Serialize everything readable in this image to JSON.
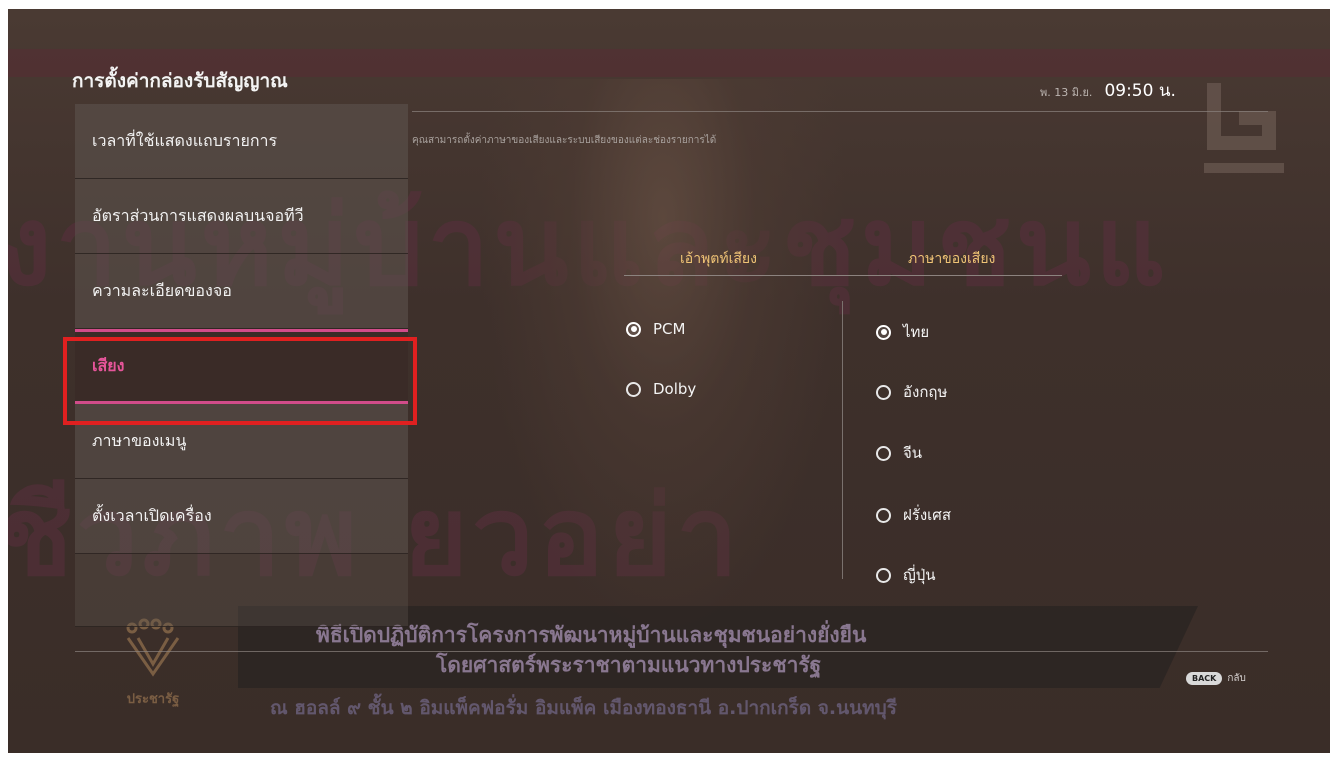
{
  "header": {
    "title": "การตั้งค่ากล่องรับสัญญาณ",
    "date": "พ. 13 มิ.ย.",
    "time": "09:50 น."
  },
  "menu": {
    "items": [
      {
        "label": "เวลาที่ใช้แสดงแถบรายการ"
      },
      {
        "label": "อัตราส่วนการแสดงผลบนจอทีวี"
      },
      {
        "label": "ความละเอียดของจอ"
      },
      {
        "label": "เสียง"
      },
      {
        "label": "ภาษาของเมนู"
      },
      {
        "label": "ตั้งเวลาเปิดเครื่อง"
      }
    ],
    "selected_index": 3
  },
  "content": {
    "description": "คุณสามารถตั้งค่าภาษาของเสียงและระบบเสียงของแต่ละช่องรายการได้",
    "audio_output": {
      "header": "เอ้าพุตท์เสียง",
      "options": [
        "PCM",
        "Dolby"
      ],
      "selected": "PCM"
    },
    "audio_language": {
      "header": "ภาษาของเสียง",
      "options": [
        "ไทย",
        "อังกฤษ",
        "จีน",
        "ฝรั่งเศส",
        "ญี่ปุ่น"
      ],
      "selected": "ไทย"
    }
  },
  "footer": {
    "back_badge": "BACK",
    "back_label": "กลับ"
  },
  "background": {
    "banner_line1": "พิธีเปิดปฏิบัติการโครงการพัฒนาหมู่บ้านและชุมชนอย่างยั่งยืน",
    "banner_line2": "โดยศาสตร์พระราชาตามแนวทางประชารัฐ",
    "banner_line3": "ณ ฮอลล์ ๙  ชั้น ๒ อิมแพ็คฟอรั่ม อิมแพ็ค เมืองทองธานี อ.ปากเกร็ด จ.นนทบุรี",
    "logo_text": "ประชารัฐ"
  },
  "colors": {
    "accent": "#d14c8a",
    "selected_text": "#e6559a",
    "column_header": "#f0c476",
    "annotation_box": "#e02020"
  }
}
